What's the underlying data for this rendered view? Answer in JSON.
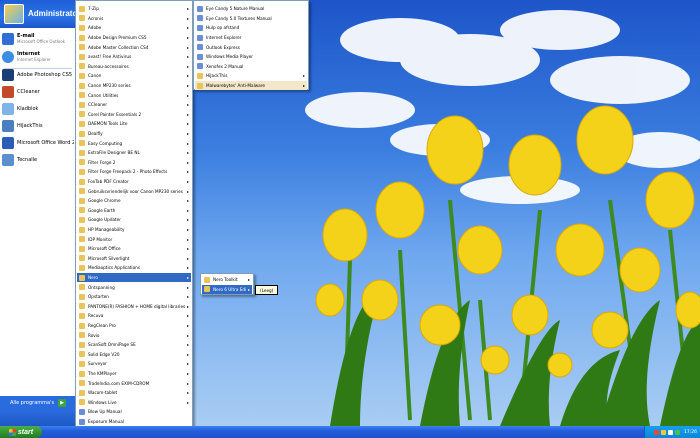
{
  "start_menu": {
    "user": "Administrato",
    "pinned": [
      {
        "title": "E-mail",
        "subtitle": "Microsoft Office Outlook",
        "icon": "mail-icon",
        "color": "#2f6fd6"
      },
      {
        "title": "Internet",
        "subtitle": "Internet Explorer",
        "icon": "ie-icon",
        "color": "#3a8de0"
      }
    ],
    "recent": [
      {
        "label": "Adobe Photoshop CS5",
        "icon": "photoshop-icon",
        "color": "#1c3f73"
      },
      {
        "label": "CCleaner",
        "icon": "ccleaner-icon",
        "color": "#c24a2a"
      },
      {
        "label": "Kladblok",
        "icon": "notepad-icon",
        "color": "#7fb4e8"
      },
      {
        "label": "HiJackThis",
        "icon": "hijackthis-icon",
        "color": "#4a7fc0"
      },
      {
        "label": "Microsoft Office Word 2007",
        "icon": "word-icon",
        "color": "#2b5cb8"
      },
      {
        "label": "Tecnalle",
        "icon": "tecnalle-icon",
        "color": "#5a8fd0"
      }
    ],
    "all_programs": "Alle programma's"
  },
  "programs_menu": [
    {
      "label": "7-Zip",
      "sub": true
    },
    {
      "label": "Acronis",
      "sub": true
    },
    {
      "label": "Adobe",
      "sub": true
    },
    {
      "label": "Adobe Design Premium CS5",
      "sub": true
    },
    {
      "label": "Adobe Master Collection CS4",
      "sub": true
    },
    {
      "label": "avast! Free Antivirus",
      "sub": true
    },
    {
      "label": "Bureau-accessoires",
      "sub": true
    },
    {
      "label": "Canon",
      "sub": true
    },
    {
      "label": "Canon MP230 series",
      "sub": true
    },
    {
      "label": "Canon Utilities",
      "sub": true
    },
    {
      "label": "CCleaner",
      "sub": true
    },
    {
      "label": "Corel Painter Essentials 2",
      "sub": true
    },
    {
      "label": "DAEMON Tools Lite",
      "sub": true
    },
    {
      "label": "Dealfly",
      "sub": true
    },
    {
      "label": "Easy Computing",
      "sub": true
    },
    {
      "label": "ExtraFile Designer BE NL",
      "sub": true
    },
    {
      "label": "Filter Forge 2",
      "sub": true
    },
    {
      "label": "Filter Forge Freepack 2 - Photo Effects",
      "sub": true
    },
    {
      "label": "FoxTab PDF Creator",
      "sub": true
    },
    {
      "label": "Gebruiksvriendelijk voor Canon MP230 series",
      "sub": true
    },
    {
      "label": "Google Chrome",
      "sub": true
    },
    {
      "label": "Google Earth",
      "sub": true
    },
    {
      "label": "Google Updater",
      "sub": true
    },
    {
      "label": "HP Manageability",
      "sub": true
    },
    {
      "label": "IDP Monitor",
      "sub": true
    },
    {
      "label": "Microsoft Office",
      "sub": true
    },
    {
      "label": "Microsoft Silverlight",
      "sub": true
    },
    {
      "label": "Mediaoptics Applications",
      "sub": true
    },
    {
      "label": "Nero",
      "sub": true,
      "state": "selected"
    },
    {
      "label": "Ontspanning",
      "sub": true
    },
    {
      "label": "Opstarten",
      "sub": true
    },
    {
      "label": "PANTONE(R) FASHION + HOME digital libraries",
      "sub": true
    },
    {
      "label": "Recuva",
      "sub": true
    },
    {
      "label": "RegClean Pro",
      "sub": true
    },
    {
      "label": "Rovio",
      "sub": true
    },
    {
      "label": "ScanSoft OmniPage SE",
      "sub": true
    },
    {
      "label": "Solid Edge V20",
      "sub": true
    },
    {
      "label": "Surveyor",
      "sub": true
    },
    {
      "label": "The KMPlayer",
      "sub": true
    },
    {
      "label": "TradeIndia.com EXIM-CDROM",
      "sub": true
    },
    {
      "label": "Wacom-tablet",
      "sub": true
    },
    {
      "label": "Windows Live",
      "sub": true
    },
    {
      "label": "Blow Up Manual",
      "sub": false
    },
    {
      "label": "Exposure Manual",
      "sub": false
    },
    {
      "label": "Eye Candy 6 Impact Manual",
      "sub": false
    }
  ],
  "right_menu": [
    {
      "label": "Eye Candy 5 Nature Manual",
      "sub": false
    },
    {
      "label": "Eye Candy 5.0 Textures Manual",
      "sub": false
    },
    {
      "label": "Hulp op afstand",
      "sub": false
    },
    {
      "label": "Internet Explorer",
      "sub": false
    },
    {
      "label": "Outlook Express",
      "sub": false
    },
    {
      "label": "Windows Media Player",
      "sub": false
    },
    {
      "label": "Xenofex 2 Manual",
      "sub": false
    },
    {
      "label": "HiJackThis",
      "sub": true
    },
    {
      "label": "Malwarebytes' Anti-Malware",
      "sub": true,
      "state": "hover"
    }
  ],
  "nero_menu": [
    {
      "label": "Nero Toolkit",
      "sub": true
    },
    {
      "label": "Nero 6 Ultra Edition",
      "sub": true,
      "state": "selected"
    }
  ],
  "tooltip": "(Leeg)",
  "taskbar": {
    "start_label": "start",
    "clock": "17:26"
  },
  "colors": {
    "menu_highlight": "#316ac5",
    "taskbar": "#245edb",
    "start_button": "#3aa53a",
    "tray": "#0e85d9"
  }
}
